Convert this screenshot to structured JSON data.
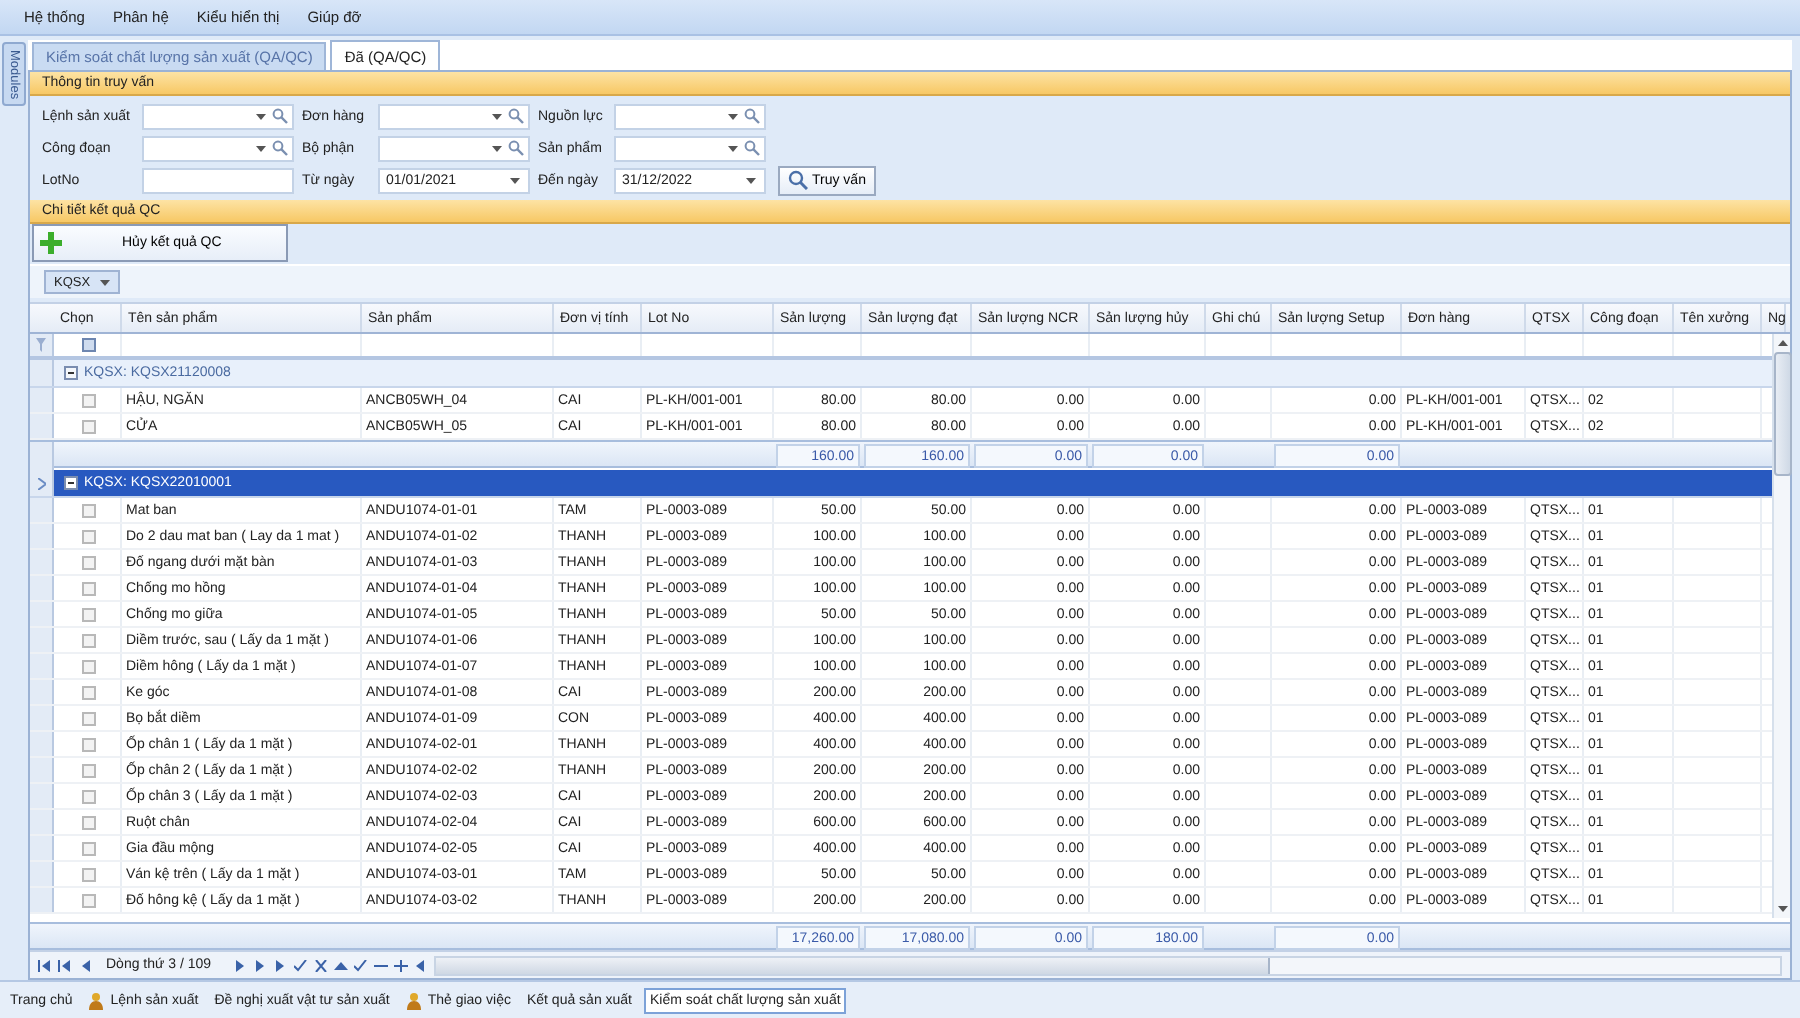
{
  "menu": [
    "Hệ thống",
    "Phân hệ",
    "Kiểu hiển thị",
    "Giúp đỡ"
  ],
  "side_tab": "Modules",
  "doc_tabs": [
    {
      "label": "Kiểm soát chất lượng sản xuất (QA/QC)",
      "selected": false
    },
    {
      "label": "Đã (QA/QC)",
      "selected": true
    }
  ],
  "query_panel": {
    "title": "Thông tin truy vấn",
    "fields": [
      {
        "label": "Lệnh sản xuất",
        "kind": "combo"
      },
      {
        "label": "Đơn hàng",
        "kind": "combo"
      },
      {
        "label": "Nguồn lực",
        "kind": "combo"
      },
      {
        "label": "Công đoạn",
        "kind": "combo"
      },
      {
        "label": "Bộ phận",
        "kind": "combo"
      },
      {
        "label": "Sản phẩm",
        "kind": "combo"
      },
      {
        "label": "LotNo",
        "kind": "text"
      },
      {
        "label": "Từ ngày",
        "kind": "date",
        "value": "01/01/2021"
      },
      {
        "label": "Đến ngày",
        "kind": "date",
        "value": "31/12/2022"
      }
    ],
    "button": "Truy vấn"
  },
  "detail_panel": {
    "title": "Chi tiết kết quả QC",
    "action_button": "Hủy kết quả QC",
    "group_chip": "KQSX",
    "grid": {
      "columns": [
        "Chọn",
        "Tên sản phẩm",
        "Sản phẩm",
        "Đơn vị tính",
        "Lot No",
        "Sản lượng",
        "Sản lượng đạt",
        "Sản lượng  NCR",
        "Sản lượng  hủy",
        "Ghi chú",
        "Sản lượng  Setup",
        "Đơn hàng",
        "QTSX",
        "Công đoạn",
        "Tên xưởng",
        "Ng"
      ],
      "groups": [
        {
          "title": "KQSX: KQSX21120008",
          "expanded": true,
          "selected": false,
          "rows": [
            {
              "checked": false,
              "name": "HẬU, NGĂN",
              "product": "ANCB05WH_04",
              "unit": "CAI",
              "lot_no": "PL-KH/001-001",
              "qty": "80.00",
              "qty_ok": "80.00",
              "qty_ncr": "0.00",
              "qty_cancel": "0.00",
              "qty_setup": "0.00",
              "order": "PL-KH/001-001",
              "process": "QTSX...",
              "stage": "02"
            },
            {
              "checked": false,
              "name": "CỬA",
              "product": "ANCB05WH_05",
              "unit": "CAI",
              "lot_no": "PL-KH/001-001",
              "qty": "80.00",
              "qty_ok": "80.00",
              "qty_ncr": "0.00",
              "qty_cancel": "0.00",
              "qty_setup": "0.00",
              "order": "PL-KH/001-001",
              "process": "QTSX...",
              "stage": "02"
            }
          ],
          "totals": {
            "qty": "160.00",
            "qty_ok": "160.00",
            "qty_ncr": "0.00",
            "qty_cancel": "0.00",
            "qty_setup": "0.00"
          }
        },
        {
          "title": "KQSX: KQSX22010001",
          "expanded": true,
          "selected": true,
          "rows": [
            {
              "checked": false,
              "name": "Mat ban",
              "product": "ANDU1074-01-01",
              "unit": "TAM",
              "lot_no": "PL-0003-089",
              "qty": "50.00",
              "qty_ok": "50.00",
              "qty_ncr": "0.00",
              "qty_cancel": "0.00",
              "qty_setup": "0.00",
              "order": "PL-0003-089",
              "process": "QTSX...",
              "stage": "01"
            },
            {
              "checked": false,
              "name": "Do 2 dau mat ban ( Lay da 1 mat )",
              "product": "ANDU1074-01-02",
              "unit": "THANH",
              "lot_no": "PL-0003-089",
              "qty": "100.00",
              "qty_ok": "100.00",
              "qty_ncr": "0.00",
              "qty_cancel": "0.00",
              "qty_setup": "0.00",
              "order": "PL-0003-089",
              "process": "QTSX...",
              "stage": "01"
            },
            {
              "checked": false,
              "name": "Đố ngang dưới mặt bàn",
              "product": "ANDU1074-01-03",
              "unit": "THANH",
              "lot_no": "PL-0003-089",
              "qty": "100.00",
              "qty_ok": "100.00",
              "qty_ncr": "0.00",
              "qty_cancel": "0.00",
              "qty_setup": "0.00",
              "order": "PL-0003-089",
              "process": "QTSX...",
              "stage": "01"
            },
            {
              "checked": false,
              "name": "Chống mo hồng",
              "product": "ANDU1074-01-04",
              "unit": "THANH",
              "lot_no": "PL-0003-089",
              "qty": "100.00",
              "qty_ok": "100.00",
              "qty_ncr": "0.00",
              "qty_cancel": "0.00",
              "qty_setup": "0.00",
              "order": "PL-0003-089",
              "process": "QTSX...",
              "stage": "01"
            },
            {
              "checked": false,
              "name": "Chống mo giữa",
              "product": "ANDU1074-01-05",
              "unit": "THANH",
              "lot_no": "PL-0003-089",
              "qty": "50.00",
              "qty_ok": "50.00",
              "qty_ncr": "0.00",
              "qty_cancel": "0.00",
              "qty_setup": "0.00",
              "order": "PL-0003-089",
              "process": "QTSX...",
              "stage": "01"
            },
            {
              "checked": false,
              "name": "Diềm trước, sau ( Lấy da 1 mặt )",
              "product": "ANDU1074-01-06",
              "unit": "THANH",
              "lot_no": "PL-0003-089",
              "qty": "100.00",
              "qty_ok": "100.00",
              "qty_ncr": "0.00",
              "qty_cancel": "0.00",
              "qty_setup": "0.00",
              "order": "PL-0003-089",
              "process": "QTSX...",
              "stage": "01"
            },
            {
              "checked": false,
              "name": "Diềm hông ( Lấy da 1 mặt )",
              "product": "ANDU1074-01-07",
              "unit": "THANH",
              "lot_no": "PL-0003-089",
              "qty": "100.00",
              "qty_ok": "100.00",
              "qty_ncr": "0.00",
              "qty_cancel": "0.00",
              "qty_setup": "0.00",
              "order": "PL-0003-089",
              "process": "QTSX...",
              "stage": "01"
            },
            {
              "checked": false,
              "name": "Ke góc",
              "product": "ANDU1074-01-08",
              "unit": "CAI",
              "lot_no": "PL-0003-089",
              "qty": "200.00",
              "qty_ok": "200.00",
              "qty_ncr": "0.00",
              "qty_cancel": "0.00",
              "qty_setup": "0.00",
              "order": "PL-0003-089",
              "process": "QTSX...",
              "stage": "01"
            },
            {
              "checked": false,
              "name": "Bọ bắt diềm",
              "product": "ANDU1074-01-09",
              "unit": "CON",
              "lot_no": "PL-0003-089",
              "qty": "400.00",
              "qty_ok": "400.00",
              "qty_ncr": "0.00",
              "qty_cancel": "0.00",
              "qty_setup": "0.00",
              "order": "PL-0003-089",
              "process": "QTSX...",
              "stage": "01"
            },
            {
              "checked": false,
              "name": "Ốp chân 1 ( Lấy da 1 mặt )",
              "product": "ANDU1074-02-01",
              "unit": "THANH",
              "lot_no": "PL-0003-089",
              "qty": "400.00",
              "qty_ok": "400.00",
              "qty_ncr": "0.00",
              "qty_cancel": "0.00",
              "qty_setup": "0.00",
              "order": "PL-0003-089",
              "process": "QTSX...",
              "stage": "01"
            },
            {
              "checked": false,
              "name": "Ốp chân 2 ( Lấy da 1 mặt )",
              "product": "ANDU1074-02-02",
              "unit": "THANH",
              "lot_no": "PL-0003-089",
              "qty": "200.00",
              "qty_ok": "200.00",
              "qty_ncr": "0.00",
              "qty_cancel": "0.00",
              "qty_setup": "0.00",
              "order": "PL-0003-089",
              "process": "QTSX...",
              "stage": "01"
            },
            {
              "checked": false,
              "name": "Ốp chân 3 ( Lấy da 1 mặt )",
              "product": "ANDU1074-02-03",
              "unit": "CAI",
              "lot_no": "PL-0003-089",
              "qty": "200.00",
              "qty_ok": "200.00",
              "qty_ncr": "0.00",
              "qty_cancel": "0.00",
              "qty_setup": "0.00",
              "order": "PL-0003-089",
              "process": "QTSX...",
              "stage": "01"
            },
            {
              "checked": false,
              "name": "Ruột chân",
              "product": "ANDU1074-02-04",
              "unit": "CAI",
              "lot_no": "PL-0003-089",
              "qty": "600.00",
              "qty_ok": "600.00",
              "qty_ncr": "0.00",
              "qty_cancel": "0.00",
              "qty_setup": "0.00",
              "order": "PL-0003-089",
              "process": "QTSX...",
              "stage": "01"
            },
            {
              "checked": false,
              "name": "Gia đầu mộng",
              "product": "ANDU1074-02-05",
              "unit": "CAI",
              "lot_no": "PL-0003-089",
              "qty": "400.00",
              "qty_ok": "400.00",
              "qty_ncr": "0.00",
              "qty_cancel": "0.00",
              "qty_setup": "0.00",
              "order": "PL-0003-089",
              "process": "QTSX...",
              "stage": "01"
            },
            {
              "checked": false,
              "name": "Ván kệ trên ( Lấy da 1 mặt )",
              "product": "ANDU1074-03-01",
              "unit": "TAM",
              "lot_no": "PL-0003-089",
              "qty": "50.00",
              "qty_ok": "50.00",
              "qty_ncr": "0.00",
              "qty_cancel": "0.00",
              "qty_setup": "0.00",
              "order": "PL-0003-089",
              "process": "QTSX...",
              "stage": "01"
            },
            {
              "checked": false,
              "name": "Đố hông kệ ( Lấy da 1 mặt )",
              "product": "ANDU1074-03-02",
              "unit": "THANH",
              "lot_no": "PL-0003-089",
              "qty": "200.00",
              "qty_ok": "200.00",
              "qty_ncr": "0.00",
              "qty_cancel": "0.00",
              "qty_setup": "0.00",
              "order": "PL-0003-089",
              "process": "QTSX...",
              "stage": "01"
            }
          ]
        }
      ],
      "footer_totals": {
        "qty": "17,260.00",
        "qty_ok": "17,080.00",
        "qty_ncr": "0.00",
        "qty_cancel": "180.00",
        "qty_setup": "0.00"
      },
      "navigator": "Dòng thứ 3 / 109"
    }
  },
  "taskbar": [
    {
      "label": "Trang chủ",
      "kind": "text",
      "selected": false
    },
    {
      "label": "Lệnh sản xuất",
      "kind": "icon",
      "selected": false
    },
    {
      "label": "Đề nghị xuất vật tư sản xuất",
      "kind": "text",
      "selected": false
    },
    {
      "label": "Thẻ giao việc",
      "kind": "icon",
      "selected": false
    },
    {
      "label": "Kết quả sản xuất",
      "kind": "text",
      "selected": false
    },
    {
      "label": "Kiểm soát chất lượng sản xuất",
      "kind": "text",
      "selected": true
    }
  ]
}
